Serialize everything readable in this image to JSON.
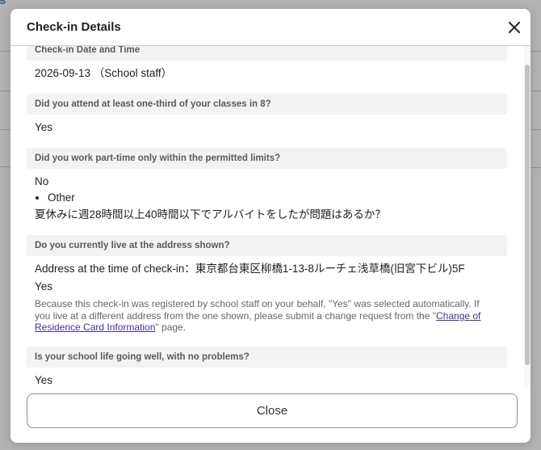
{
  "backdrop": {
    "partial_text": "s"
  },
  "modal": {
    "title": "Check-in Details",
    "close_icon": "close-icon",
    "close_button_label": "Close"
  },
  "details": {
    "checkin": {
      "label": "Check-in Date and Time",
      "value": "2026-09-13 （School staff）"
    },
    "attendance": {
      "label": "Did you attend at least one-third of your classes in 8?",
      "value": "Yes"
    },
    "part_time": {
      "label": "Did you work part-time only within the permitted limits?",
      "value": "No",
      "options": [
        "Other"
      ],
      "comment": "夏休みに週28時間以上40時間以下でアルバイトをしたが問題はあるか？"
    },
    "address": {
      "label": "Do you currently live at the address shown?",
      "address_line": "Address at the time of check-in：東京都台東区柳橋1-13-8ルーチェ浅草橋(旧宮下ビル)5F",
      "value": "Yes",
      "note": {
        "before": "Because this check-in was registered by school staff on your behalf, \"Yes\" was selected automatically. If you live at a different address from the one shown, please submit a change request from the \"",
        "link": "Change of Residence Card Information",
        "after": "\" page."
      }
    },
    "school_life": {
      "label": "Is your school life going well, with no problems?",
      "value": "Yes"
    }
  },
  "colors": {
    "backdrop": "#b3b3b3",
    "section_bg": "#f3f3f3",
    "link": "#4b2f8f",
    "text": "#1f1f1f"
  }
}
